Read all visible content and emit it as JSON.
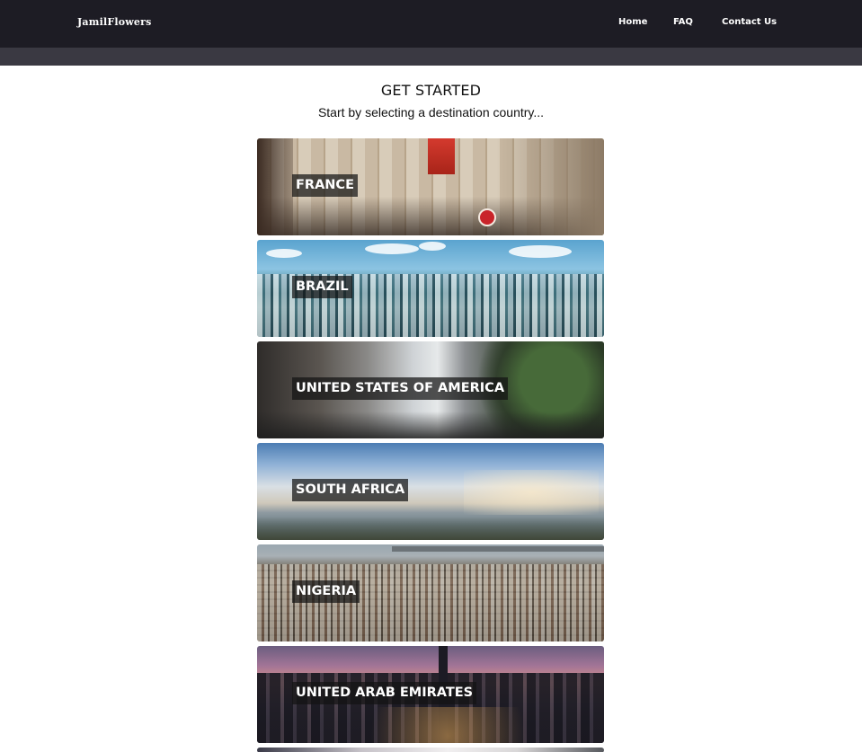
{
  "navbar": {
    "brand": "JamilFlowers",
    "links": [
      "Home",
      "FAQ",
      "Contact Us"
    ]
  },
  "page": {
    "heading": "GET STARTED",
    "subheading": "Start by selecting a destination country..."
  },
  "countries": [
    {
      "name": "FRANCE"
    },
    {
      "name": "BRAZIL"
    },
    {
      "name": "UNITED STATES OF AMERICA"
    },
    {
      "name": "SOUTH AFRICA"
    },
    {
      "name": "NIGERIA"
    },
    {
      "name": "UNITED ARAB EMIRATES"
    }
  ],
  "colors": {
    "navbar_bg": "#1d1c24",
    "subbar_bg": "#3a3942",
    "label_bg": "#141414"
  }
}
